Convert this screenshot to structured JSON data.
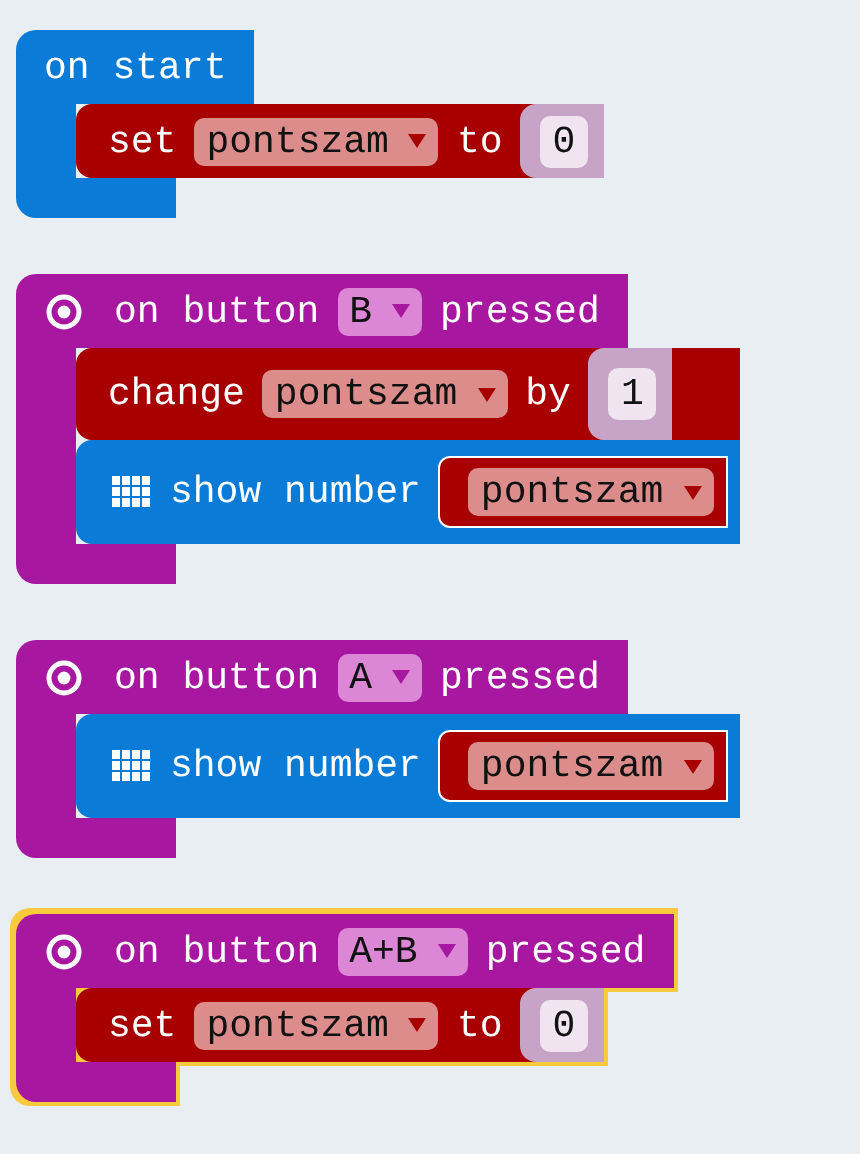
{
  "blocks": [
    {
      "kind": "start",
      "selected": false,
      "label": "on start",
      "statements": [
        {
          "kind": "set",
          "keyword": "set",
          "variable": "pontszam",
          "connector": "to",
          "value": "0"
        }
      ]
    },
    {
      "kind": "button",
      "selected": false,
      "prefix": "on button",
      "button": "B",
      "suffix": "pressed",
      "statements": [
        {
          "kind": "change",
          "keyword": "change",
          "variable": "pontszam",
          "connector": "by",
          "value": "1"
        },
        {
          "kind": "show",
          "keyword": "show number",
          "variable": "pontszam"
        }
      ]
    },
    {
      "kind": "button",
      "selected": false,
      "prefix": "on button",
      "button": "A",
      "suffix": "pressed",
      "statements": [
        {
          "kind": "show",
          "keyword": "show number",
          "variable": "pontszam"
        }
      ]
    },
    {
      "kind": "button",
      "selected": true,
      "prefix": "on button",
      "button": "A+B",
      "suffix": "pressed",
      "statements": [
        {
          "kind": "set",
          "keyword": "set",
          "variable": "pontszam",
          "connector": "to",
          "value": "0"
        }
      ]
    }
  ]
}
